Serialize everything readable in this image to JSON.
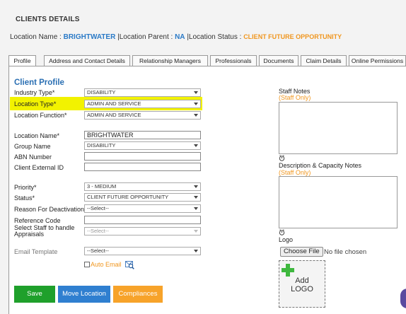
{
  "header": {
    "title": "CLIENTS DETAILS",
    "location_name_label": "Location Name :",
    "location_name": "BRIGHTWATER",
    "location_parent_label": "|Location Parent :",
    "location_parent": "NA",
    "location_status_label": "|Location Status :",
    "location_status": "CLIENT FUTURE OPPORTUNITY"
  },
  "tabs": [
    {
      "label": "Profile"
    },
    {
      "label": "Address and Contact Details"
    },
    {
      "label": "Relationship Managers"
    },
    {
      "label": "Professionals"
    },
    {
      "label": "Documents"
    },
    {
      "label": "Claim Details"
    },
    {
      "label": "Online Permissions"
    }
  ],
  "profile": {
    "section_title": "Client Profile",
    "industry_type": {
      "label": "Industry Type*",
      "value": "DISABILITY"
    },
    "location_type": {
      "label": "Location Type*",
      "value": "ADMIN AND SERVICE"
    },
    "location_function": {
      "label": "Location Function*",
      "value": "ADMIN AND SERVICE"
    },
    "location_name": {
      "label": "Location Name*",
      "value": "BRIGHTWATER"
    },
    "group_name": {
      "label": "Group Name",
      "value": "DISABILITY"
    },
    "abn_number": {
      "label": "ABN Number",
      "value": ""
    },
    "client_external_id": {
      "label": "Client External ID",
      "value": ""
    },
    "priority": {
      "label": "Priority*",
      "value": "3 - MEDIUM"
    },
    "status": {
      "label": "Status*",
      "value": "CLIENT FUTURE OPPORTUNITY"
    },
    "reason_for_deactivation": {
      "label": "Reason For Deactivation",
      "value": "--Select--"
    },
    "reference_code": {
      "label": "Reference Code",
      "value": ""
    },
    "select_staff_line1": "Select Staff to handle",
    "select_staff_line2": "Appraisals",
    "select_staff_value": "--Select--",
    "email_template": {
      "label": "Email Template",
      "value": "--Select--"
    },
    "auto_email_label": "Auto Email"
  },
  "right": {
    "staff_notes_label": "Staff Notes",
    "staff_notes_sub": "(Staff Only)",
    "desc_label": "Description & Capacity Notes",
    "desc_sub": "(Staff Only)",
    "logo_label": "Logo",
    "choose_file_label": "Choose File",
    "no_file_text": "No file chosen",
    "add_logo_line1": "Add",
    "add_logo_line2": "LOGO"
  },
  "buttons": {
    "save": "Save",
    "move_location": "Move Location",
    "compliances": "Compliances"
  },
  "colors": {
    "save": "#1fa02b",
    "move_location": "#2f7fd0",
    "compliances": "#f7a32a",
    "highlight": "#f2f200",
    "accent_blue": "#2a7ac7",
    "accent_orange": "#f0961e"
  }
}
